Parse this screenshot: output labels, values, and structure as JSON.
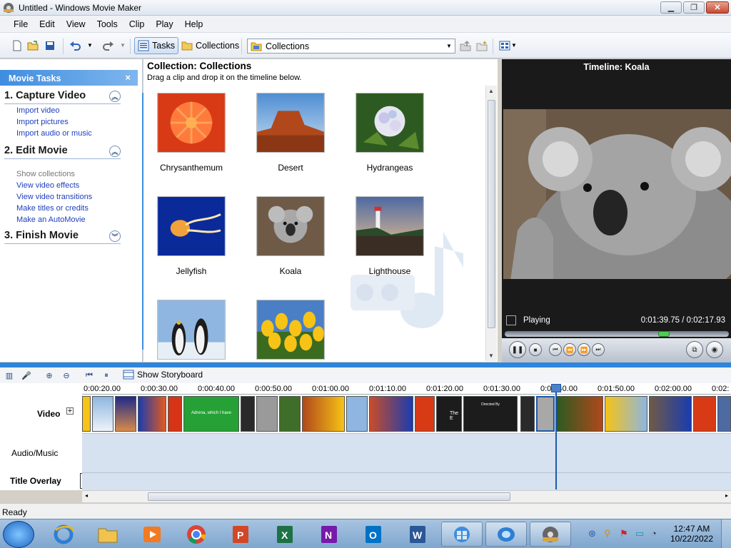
{
  "window": {
    "title": "Untitled - Windows Movie Maker"
  },
  "menu": [
    "File",
    "Edit",
    "View",
    "Tools",
    "Clip",
    "Play",
    "Help"
  ],
  "toolbar": {
    "tasks_label": "Tasks",
    "collections_label": "Collections",
    "combo_value": "Collections"
  },
  "task_pane": {
    "header": "Movie Tasks",
    "close": "×",
    "sections": [
      {
        "title": "1. Capture Video",
        "chevron": "︽",
        "links": [
          "Import video",
          "Import pictures",
          "Import audio or music"
        ]
      },
      {
        "title": "2. Edit Movie",
        "chevron": "︽",
        "links": [
          "Show collections",
          "View video effects",
          "View video transitions",
          "Make titles or credits",
          "Make an AutoMovie"
        ]
      },
      {
        "title": "3. Finish Movie",
        "chevron": "︾",
        "links": []
      }
    ]
  },
  "collection": {
    "title": "Collection: Collections",
    "subtitle": "Drag a clip and drop it on the timeline below.",
    "items": [
      "Chrysanthemum",
      "Desert",
      "Hydrangeas",
      "Jellyfish",
      "Koala",
      "Lighthouse",
      "Penguins",
      "Tulips"
    ]
  },
  "monitor": {
    "title": "Timeline: Koala",
    "status": "Playing",
    "time": "0:01:39.75 / 0:02:17.93",
    "seek_fraction": 0.72
  },
  "timeline": {
    "storyboard_label": "Show Storyboard",
    "ruler": [
      "0:00:20.00",
      "0:00:30.00",
      "0:00:40.00",
      "0:00:50.00",
      "0:01:00.00",
      "0:01:10.00",
      "0:01:20.00",
      "0:01:30.00",
      "0:01:40.00",
      "0:01:50.00",
      "0:02:00.00",
      "0:02:"
    ],
    "tracks": {
      "video": "Video",
      "audio": "Audio/Music",
      "title": "Title Overlay"
    },
    "title_clip_text": "Adrena, which I have",
    "clip_text_2": "The E",
    "clip_text_3": "Directed By"
  },
  "status": "Ready",
  "taskbar": {
    "time": "12:47 AM",
    "date": "10/22/2022"
  },
  "colors": {
    "accent": "#2d85dc",
    "link": "#1e3fbe"
  }
}
